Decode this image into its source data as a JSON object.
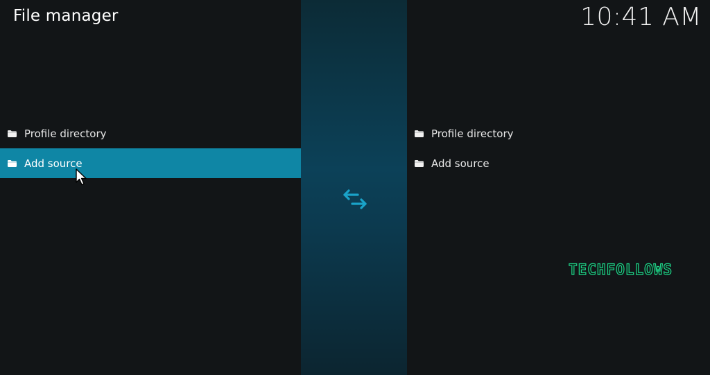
{
  "header": {
    "title": "File manager",
    "clock": "10:41 AM"
  },
  "left_pane": {
    "items": [
      {
        "label": "Profile directory",
        "icon": "folder-icon",
        "selected": false
      },
      {
        "label": "Add source",
        "icon": "folder-icon",
        "selected": true
      }
    ]
  },
  "right_pane": {
    "items": [
      {
        "label": "Profile directory",
        "icon": "folder-icon",
        "selected": false
      },
      {
        "label": "Add source",
        "icon": "folder-icon",
        "selected": false
      }
    ]
  },
  "center": {
    "icon": "swap-arrows-icon"
  },
  "watermark": {
    "text": "TECHFOLLOWS"
  },
  "colors": {
    "background": "#121517",
    "selection": "#0f86a5",
    "accent_icon": "#1aa3c9",
    "watermark": "#1fd68a"
  }
}
